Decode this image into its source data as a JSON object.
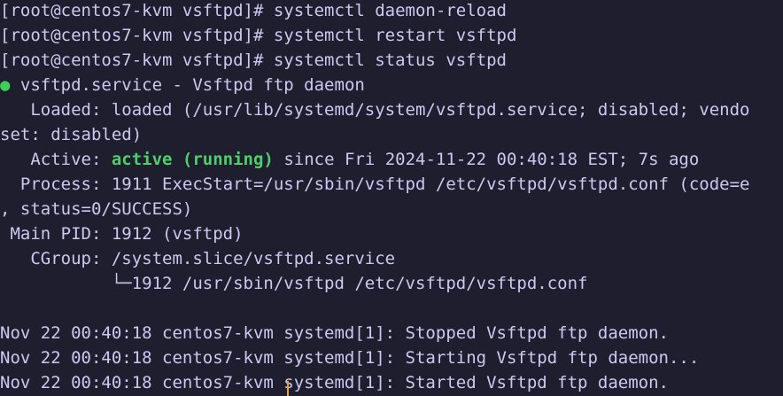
{
  "terminal": {
    "lines": [
      "[root@centos7-kvm vsftpd]# systemctl daemon-reload",
      "[root@centos7-kvm vsftpd]# systemctl restart vsftpd",
      "[root@centos7-kvm vsftpd]# systemctl status vsftpd"
    ],
    "status": {
      "dot": "●",
      "service_line": " vsftpd.service - Vsftpd ftp daemon",
      "loaded": "   Loaded: loaded (/usr/lib/systemd/system/vsftpd.service; disabled; vendo",
      "loaded_wrap": "set: disabled)",
      "active_label": "   Active: ",
      "active_state": "active (running)",
      "active_rest": " since Fri 2024-11-22 00:40:18 EST; 7s ago",
      "process": "  Process: 1911 ExecStart=/usr/sbin/vsftpd /etc/vsftpd/vsftpd.conf (code=e",
      "process_wrap": ", status=0/SUCCESS)",
      "main_pid": " Main PID: 1912 (vsftpd)",
      "cgroup": "   CGroup: /system.slice/vsftpd.service",
      "cgroup_child": "           └─1912 /usr/sbin/vsftpd /etc/vsftpd/vsftpd.conf"
    },
    "logs": [
      "Nov 22 00:40:18 centos7-kvm systemd[1]: Stopped Vsftpd ftp daemon.",
      "Nov 22 00:40:18 centos7-kvm systemd[1]: Starting Vsftpd ftp daemon...",
      "Nov 22 00:40:18 centos7-kvm systemd[1]: Started Vsftpd ftp daemon."
    ],
    "colors": {
      "background": "#1e1e2e",
      "text": "#cdc8f2",
      "active": "#4fcf6a",
      "dot": "#3ecf5a",
      "cursor": "#e8a23a"
    }
  }
}
